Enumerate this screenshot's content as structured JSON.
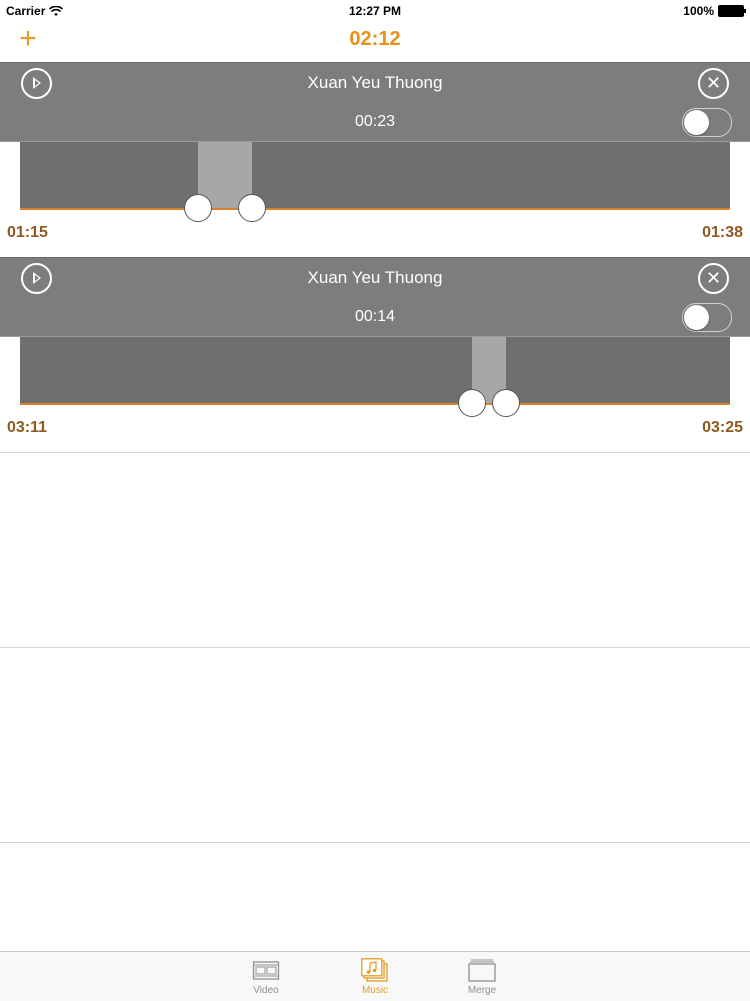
{
  "status_bar": {
    "carrier": "Carrier",
    "time": "12:27 PM",
    "battery": "100%"
  },
  "nav": {
    "add_label": "+",
    "title": "02:12"
  },
  "tracks": [
    {
      "title": "Xuan Yeu Thuong",
      "duration": "00:23",
      "start": "01:15",
      "end": "01:38",
      "toggle_on": false,
      "selection": [
        0.25,
        0.327
      ]
    },
    {
      "title": "Xuan Yeu Thuong",
      "duration": "00:14",
      "start": "03:11",
      "end": "03:25",
      "toggle_on": false,
      "selection": [
        0.637,
        0.685
      ]
    }
  ],
  "tabs": [
    {
      "label": "Video",
      "icon": "film-icon",
      "active": false
    },
    {
      "label": "Music",
      "icon": "music-icon",
      "active": true
    },
    {
      "label": "Merge",
      "icon": "merge-icon",
      "active": false
    }
  ],
  "colors": {
    "accent": "#e89a1f",
    "track_bg": "#7d7c7f",
    "wave_bg": "#6f6e70",
    "selection": "#a7a6a9",
    "time_text": "#8e5a22"
  }
}
